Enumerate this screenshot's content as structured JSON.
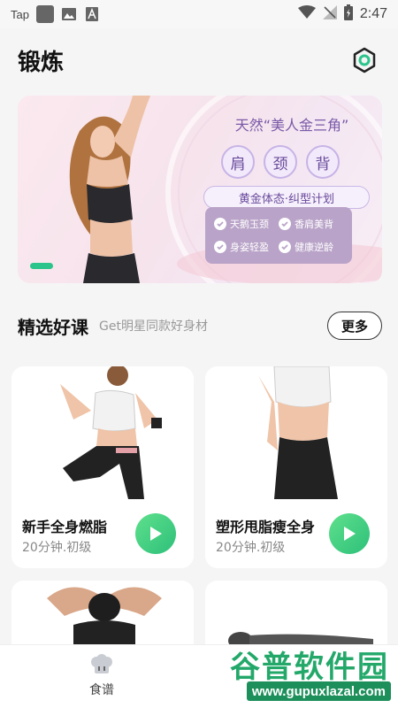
{
  "status_bar": {
    "app_label": "Tap",
    "time": "2:47"
  },
  "header": {
    "title": "锻炼"
  },
  "banner": {
    "subtitle": "天然“美人金三角”",
    "tags": [
      "肩",
      "颈",
      "背"
    ],
    "plan": "黄金体态·纠型计划",
    "features": [
      "天鹅玉颈",
      "香肩美背",
      "身姿轻盈",
      "健康逆龄"
    ],
    "indicator_color": "#2bc48a"
  },
  "section": {
    "title": "精选好课",
    "subtitle": "Get明星同款好身材",
    "more_label": "更多"
  },
  "courses": [
    {
      "name": "新手全身燃脂",
      "meta": "20分钟.初级"
    },
    {
      "name": "塑形甩脂瘦全身",
      "meta": "20分钟.初级"
    }
  ],
  "bottom_nav": {
    "items": [
      {
        "label": "食谱",
        "icon": "chef-hat-icon"
      }
    ]
  },
  "watermark": {
    "top": "谷普软件园",
    "bottom": "www.gupuxlazal.com"
  },
  "colors": {
    "accent": "#2ec07a",
    "banner_purple": "#7a5aa8"
  }
}
